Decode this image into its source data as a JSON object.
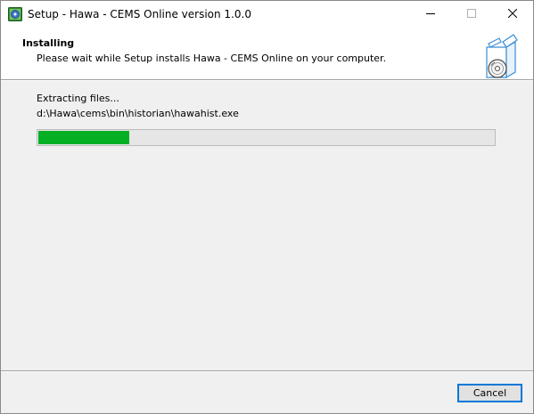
{
  "window": {
    "title": "Setup - Hawa - CEMS Online version 1.0.0",
    "app_icon": "setup-app-icon",
    "controls": {
      "minimize_icon": "minimize-icon",
      "maximize_icon": "maximize-icon",
      "close_icon": "close-icon"
    }
  },
  "header": {
    "title": "Installing",
    "subtitle": "Please wait while Setup installs Hawa - CEMS Online on your computer.",
    "graphic_icon": "install-box-disc-icon"
  },
  "main": {
    "status": "Extracting files...",
    "current_file": "d:\\Hawa\\cems\\bin\\historian\\hawahist.exe",
    "progress": {
      "fraction": 0.2,
      "fill_color": "#06b025"
    }
  },
  "footer": {
    "cancel_label": "Cancel"
  },
  "colors": {
    "accent": "#0078d7",
    "progress_green": "#06b025",
    "background": "#f0f0f0"
  }
}
